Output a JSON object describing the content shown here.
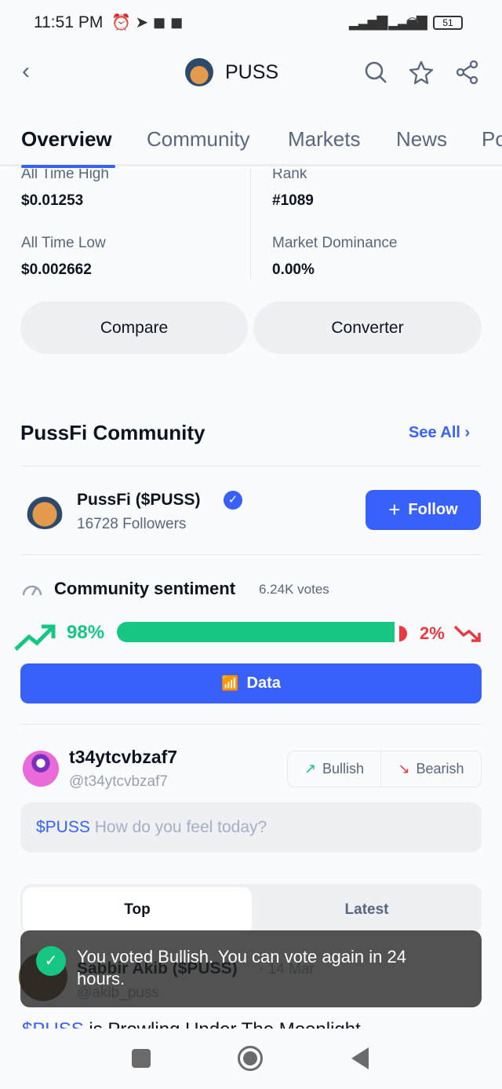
{
  "status_bar": {
    "time": "11:51 PM",
    "battery": "51"
  },
  "header": {
    "title": "PUSS"
  },
  "tabs": [
    "Overview",
    "Community",
    "Markets",
    "News",
    "Po"
  ],
  "stats": {
    "ath_label": "All Time High",
    "ath": "$0.01253",
    "atl_label": "All Time Low",
    "atl": "$0.002662",
    "rank_label": "Rank",
    "rank": "#1089",
    "dom_label": "Market Dominance",
    "dom": "0.00%"
  },
  "buttons": {
    "compare": "Compare",
    "converter": "Converter"
  },
  "community": {
    "title": "PussFi Community",
    "see_all": "See All",
    "name": "PussFi ($PUSS)",
    "followers": "16728 Followers",
    "follow": "Follow"
  },
  "sentiment": {
    "title": "Community sentiment",
    "votes": "6.24K votes",
    "bullish_pct": "98%",
    "bearish_pct": "2%",
    "bullish_value": 98,
    "data_label": "Data",
    "colors": {
      "bullish": "#16c784",
      "bearish": "#ea3943",
      "accent": "#3861fb"
    }
  },
  "composer": {
    "username": "t34ytcvbzaf7",
    "handle": "@t34ytcvbzaf7",
    "bullish": "Bullish",
    "bearish": "Bearish",
    "ticker": "$PUSS",
    "placeholder": "How do you feel today?"
  },
  "feed": {
    "tabs": [
      "Top",
      "Latest"
    ],
    "post": {
      "author": "Sabbir Akib ($PUSS)",
      "date": "· 14 Mar",
      "handle": "@akib_puss",
      "ticker": "$PUSS",
      "text": "is Prowling Under The Moonlight"
    }
  },
  "toast": {
    "message": "You voted Bullish. You can vote again in 24 hours."
  }
}
